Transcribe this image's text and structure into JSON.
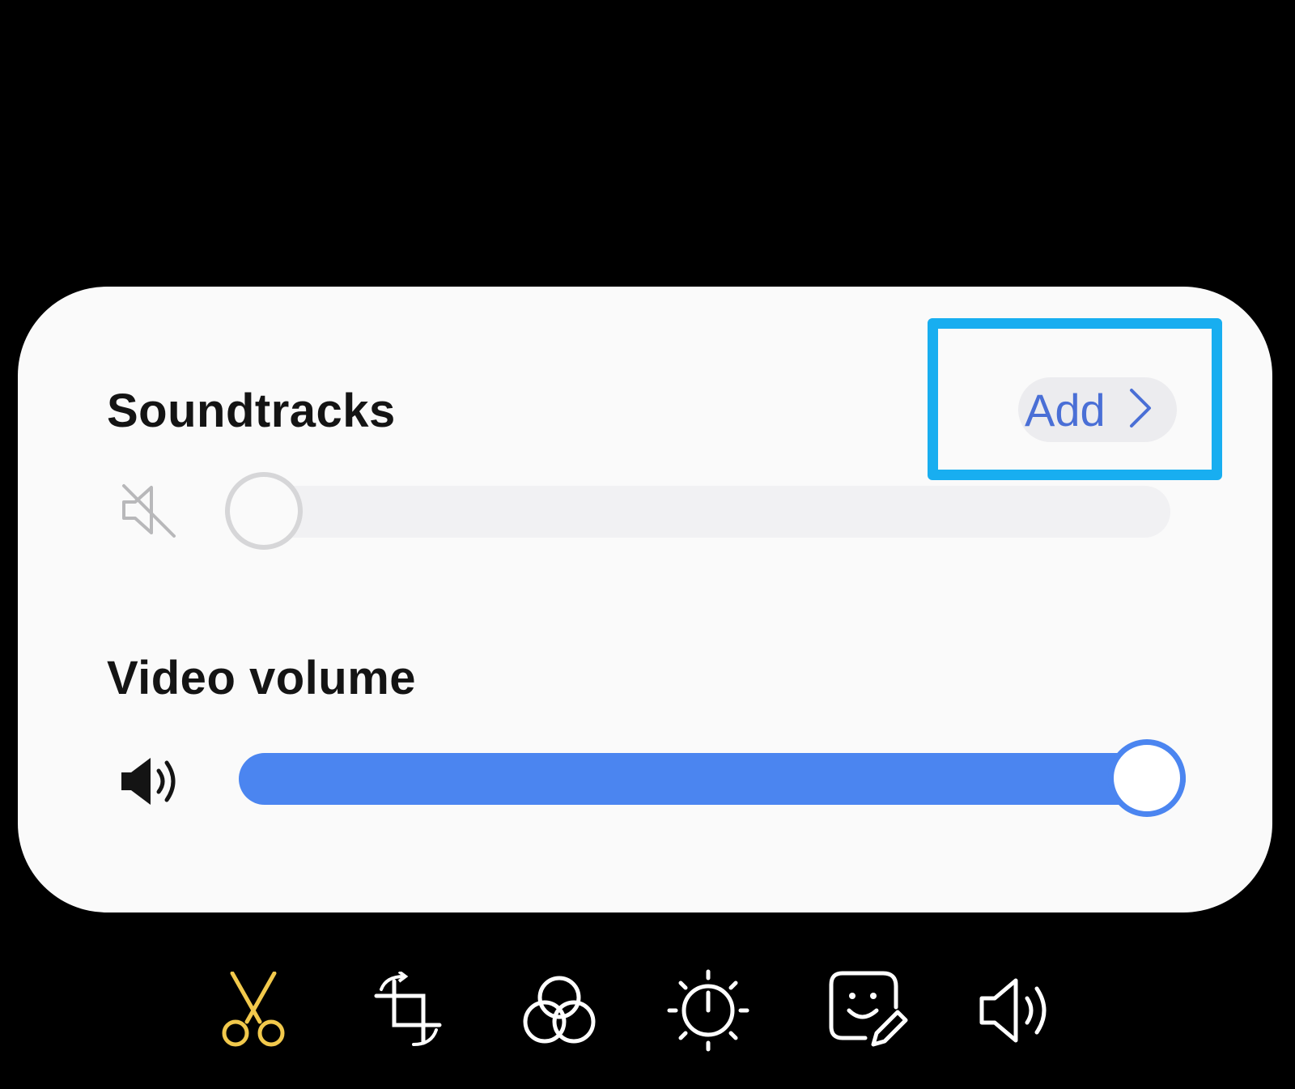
{
  "soundtracks": {
    "title": "Soundtracks",
    "add_label": "Add"
  },
  "video_volume": {
    "title": "Video volume",
    "level": 1.0
  },
  "toolbar": {
    "active_color": "#f2c94c",
    "tools": [
      "scissors-icon",
      "crop-rotate-icon",
      "filters-icon",
      "brightness-icon",
      "sticker-icon",
      "speaker-icon"
    ]
  },
  "colors": {
    "accent": "#4b85f0",
    "highlight": "#18aef0"
  }
}
